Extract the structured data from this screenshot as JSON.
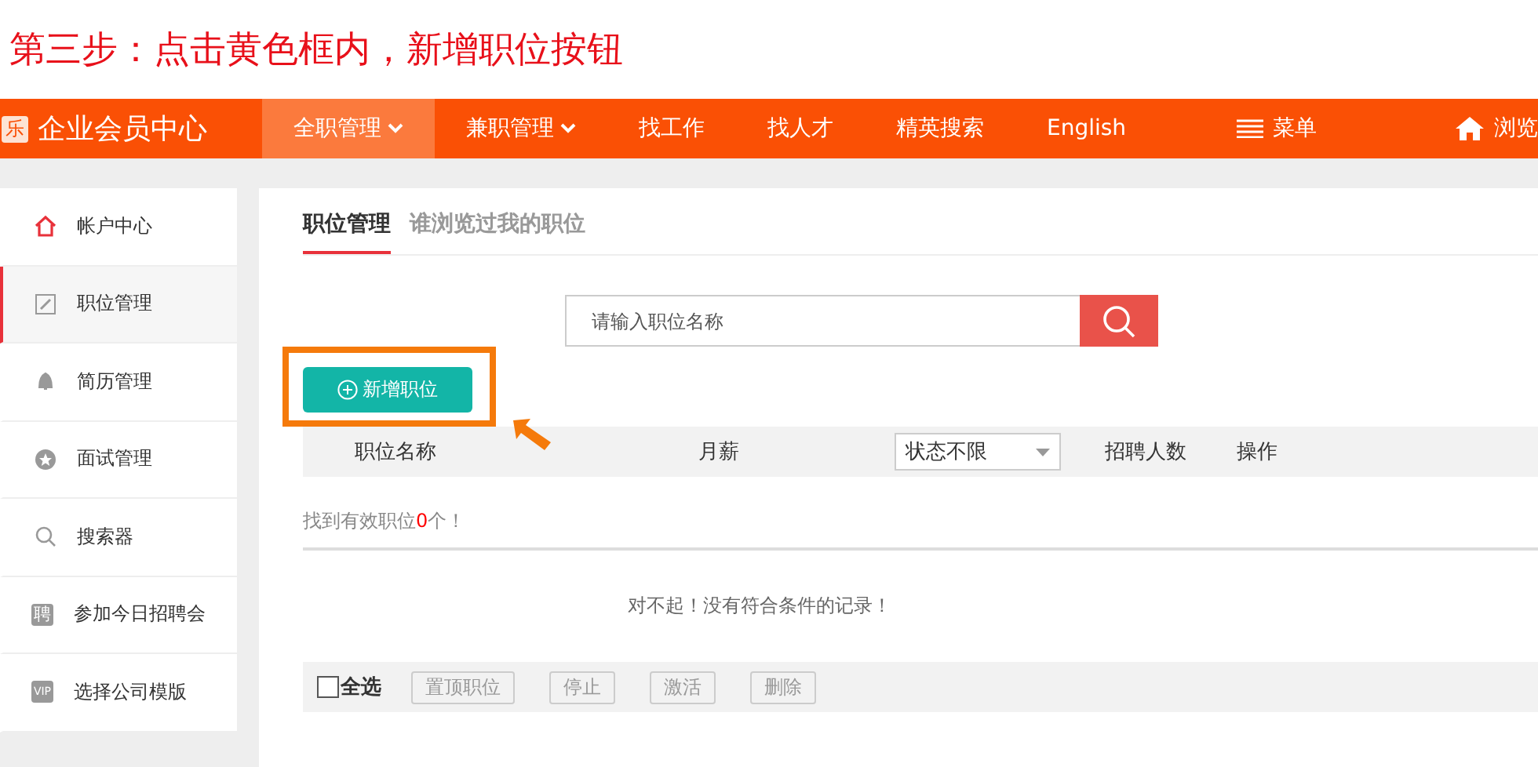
{
  "instruction": "第三步：点击黄色框内，新增职位按钮",
  "header": {
    "logo_glyph": "乐",
    "site_title": "企业会员中心",
    "nav": [
      {
        "label": "全职管理",
        "dropdown": true,
        "selected": true
      },
      {
        "label": "兼职管理",
        "dropdown": true,
        "selected": false
      },
      {
        "label": "找工作",
        "dropdown": false,
        "selected": false
      },
      {
        "label": "找人才",
        "dropdown": false,
        "selected": false
      },
      {
        "label": "精英搜索",
        "dropdown": false,
        "selected": false
      },
      {
        "label": "English",
        "dropdown": false,
        "selected": false
      }
    ],
    "menu": "菜单",
    "browse": "浏览"
  },
  "sidebar": {
    "items": [
      {
        "kind": "home",
        "label": "帐户中心",
        "selected": false
      },
      {
        "kind": "edit",
        "label": "职位管理",
        "selected": true
      },
      {
        "kind": "bell",
        "label": "简历管理",
        "selected": false
      },
      {
        "kind": "star",
        "label": "面试管理",
        "selected": false
      },
      {
        "kind": "search",
        "label": "搜索器",
        "selected": false
      },
      {
        "kind": "glyph",
        "glyph": "聘",
        "label": "参加今日招聘会",
        "selected": false
      },
      {
        "kind": "glyph",
        "glyph": "VIP",
        "label": "选择公司模版",
        "selected": false
      }
    ]
  },
  "main": {
    "tabs": [
      {
        "label": "职位管理",
        "selected": true
      },
      {
        "label": "谁浏览过我的职位",
        "selected": false
      }
    ],
    "search": {
      "placeholder": "请输入职位名称"
    },
    "add_button": "新增职位",
    "annotation": {
      "highlight": true,
      "arrow": true
    },
    "table": {
      "columns": [
        {
          "kind": "text",
          "label": "职位名称"
        },
        {
          "kind": "text",
          "label": "月薪"
        },
        {
          "kind": "select",
          "label": "状态不限"
        },
        {
          "kind": "text",
          "label": "招聘人数"
        },
        {
          "kind": "text",
          "label": "操作"
        }
      ],
      "count_prefix": "找到有效职位",
      "count": "0",
      "count_suffix": "个！",
      "empty_message": "对不起！没有符合条件的记录！"
    },
    "footer": {
      "select_all": {
        "label": "全选",
        "checked": false
      },
      "actions": [
        "置顶职位",
        "停止",
        "激活",
        "删除"
      ]
    }
  }
}
